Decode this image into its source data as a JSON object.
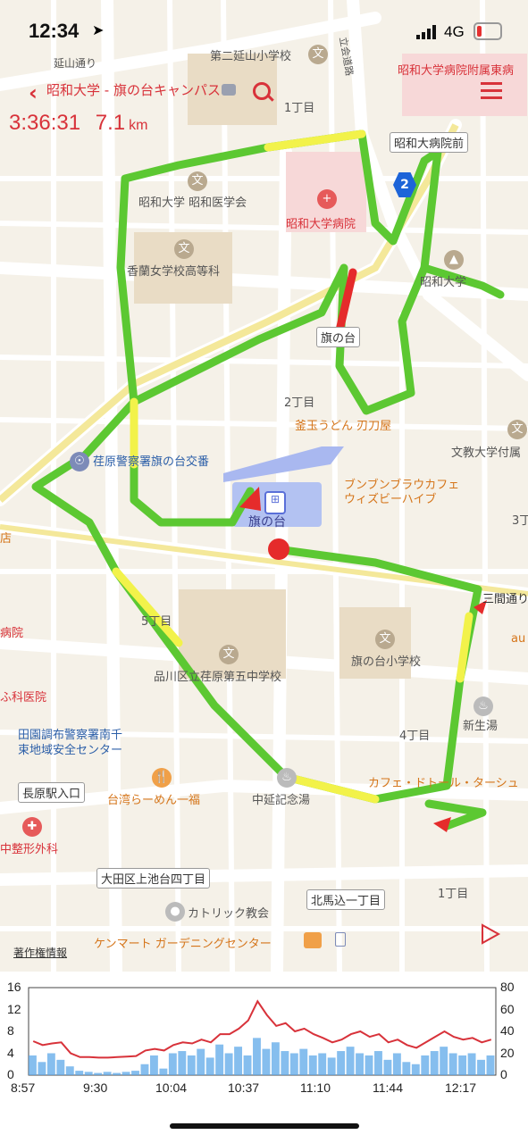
{
  "status_bar": {
    "time": "12:34",
    "network": "4G"
  },
  "header": {
    "route_title": "昭和大学 - 旗の台キャンパス",
    "elapsed": "3:36:31",
    "distance_value": "7.1",
    "distance_unit": "km"
  },
  "map": {
    "labels": {
      "school_top": "第二延山小学校",
      "street_top": "延山通り",
      "road_kanpachi": "立会道路",
      "hospital_top": "昭和大学病院附属東病",
      "chome1": "1丁目",
      "showa_mae": "昭和大病院前",
      "showa_igakkai": "昭和大学 昭和医学会",
      "showa_hospital": "昭和大学病院",
      "kouran": "香蘭女学校高等科",
      "showa_univ": "昭和大学",
      "hatanodai_stop": "旗の台",
      "chome2": "2丁目",
      "kamatama": "釜玉うどん 刃刀屋",
      "bunkyo": "文教大学付属",
      "police_box": "荏原警察署旗の台交番",
      "cafe_top": "ブンブンブラウカフェ",
      "cafe_bottom": "ウィズビーハイブ",
      "station": "旗の台",
      "chome3": "3丁",
      "store": "店",
      "sankendori": "三間通り",
      "chome5": "5丁目",
      "hatanodai_elem": "旗の台小学校",
      "au": "au",
      "clinic": "病院",
      "dental": "ふ科医院",
      "ebara5": "品川区立荏原第五中学校",
      "den_police_1": "田園調布警察署南千",
      "den_police_2": "束地域安全センター",
      "shinseiyu": "新生湯",
      "chome4": "4丁目",
      "cafe_doutor": "カフェ・ドトール・ターシュ",
      "nagahara": "長原駅入口",
      "taiwan": "台湾らーめん一福",
      "nakanobu": "中延記念湯",
      "seikei": "中整形外科",
      "kamiike": "大田区上池台四丁目",
      "kitamagome": "北馬込一丁目",
      "chome1b": "1丁目",
      "catholic": "カトリック教会",
      "kenmart": "ケンマート ガーデニングセンター",
      "copyright": "著作権情報"
    },
    "shield": "2",
    "route_colors": {
      "fast": "#5cc832",
      "medium": "#f2f24a",
      "slow": "#e52b2b"
    }
  },
  "chart_data": {
    "type": "line",
    "x_ticks": [
      "8:57",
      "9:30",
      "10:04",
      "10:37",
      "11:10",
      "11:44",
      "12:17"
    ],
    "left_axis_ticks": [
      "16",
      "12",
      "8",
      "4",
      "0"
    ],
    "right_axis_ticks": [
      "80",
      "60",
      "40",
      "20",
      "0"
    ],
    "ylim_left": [
      0,
      16
    ],
    "ylim_right": [
      0,
      80
    ],
    "series": [
      {
        "axis": "left",
        "color": "#d8323a",
        "values": [
          6.2,
          5.5,
          5.8,
          6.0,
          4.0,
          3.3,
          3.3,
          3.2,
          3.2,
          3.3,
          3.4,
          3.5,
          4.5,
          4.8,
          4.5,
          5.5,
          6.0,
          5.8,
          6.5,
          6.0,
          7.5,
          7.5,
          8.5,
          10.0,
          13.5,
          11.0,
          9.0,
          9.5,
          8.0,
          8.5,
          7.5,
          6.8,
          6.0,
          6.5,
          7.5,
          8.0,
          7.0,
          7.5,
          6.0,
          6.5,
          5.5,
          5.0,
          6.0,
          7.0,
          8.0,
          7.0,
          6.5,
          6.8,
          6.0,
          6.5
        ]
      },
      {
        "axis": "right",
        "color": "#5ea8e8",
        "values": [
          18,
          12,
          20,
          14,
          8,
          4,
          3,
          2,
          3,
          2,
          3,
          4,
          10,
          18,
          6,
          20,
          22,
          18,
          24,
          16,
          28,
          20,
          26,
          18,
          34,
          24,
          30,
          22,
          20,
          24,
          18,
          20,
          16,
          22,
          26,
          20,
          18,
          22,
          14,
          20,
          12,
          10,
          18,
          22,
          26,
          20,
          18,
          20,
          14,
          18
        ]
      }
    ]
  }
}
